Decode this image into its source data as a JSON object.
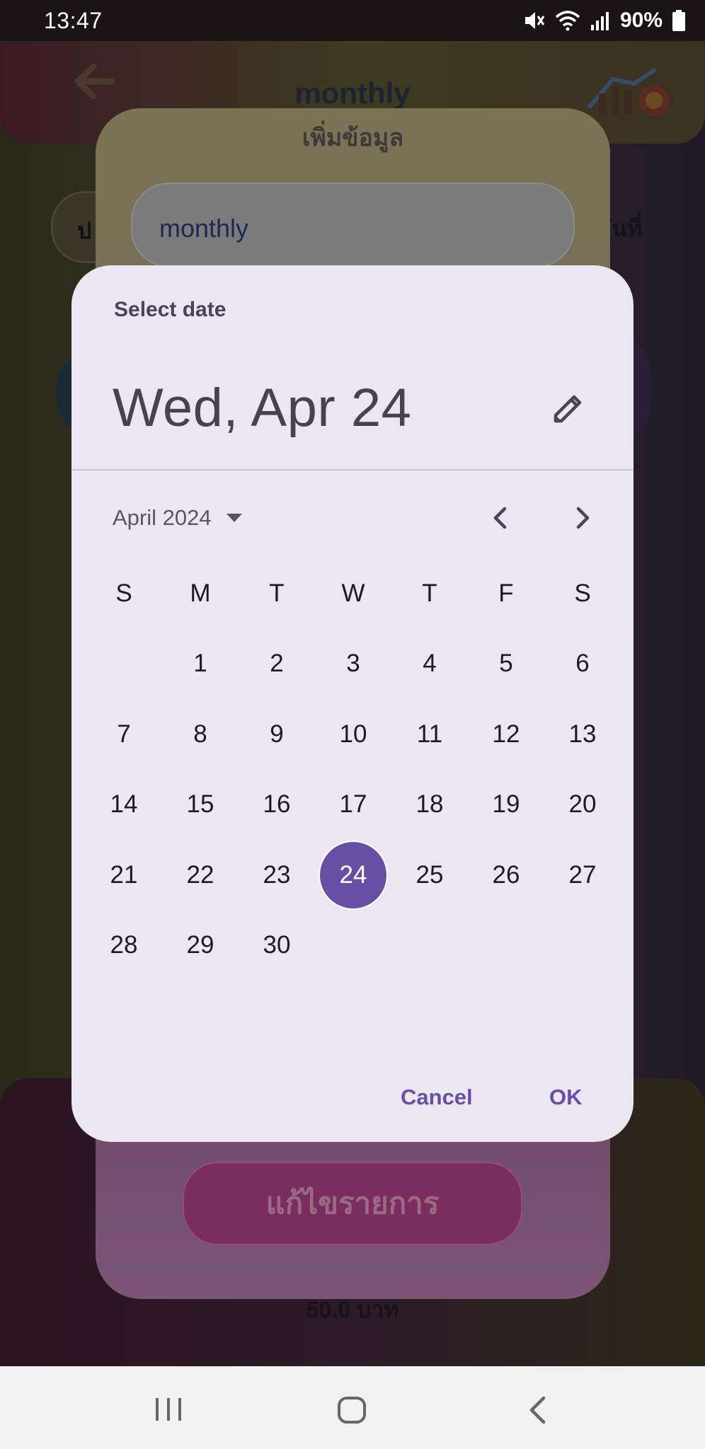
{
  "status_bar": {
    "time": "13:47",
    "battery": "90%"
  },
  "background_app": {
    "title": "monthly",
    "left_pill_text": "ป",
    "right_text": "วันที่",
    "bottom_text": "50.0 บาท"
  },
  "edit_dialog": {
    "title": "เพิ่มข้อมูล",
    "name_value": "monthly",
    "edit_button_label": "แก้ไขรายการ"
  },
  "date_picker": {
    "label": "Select date",
    "selected_date_text": "Wed, Apr 24",
    "month_year": "April 2024",
    "weekdays": [
      "S",
      "M",
      "T",
      "W",
      "T",
      "F",
      "S"
    ],
    "first_weekday_offset": 1,
    "days_in_month": 30,
    "selected_day": 24,
    "cancel_label": "Cancel",
    "ok_label": "OK"
  },
  "colors": {
    "accent": "#6750a4",
    "picker_surface": "#ece6f3"
  },
  "icons": {
    "edit": "pencil-icon",
    "prev_month": "chevron-left-icon",
    "next_month": "chevron-right-icon",
    "month_dropdown": "caret-down-icon"
  }
}
